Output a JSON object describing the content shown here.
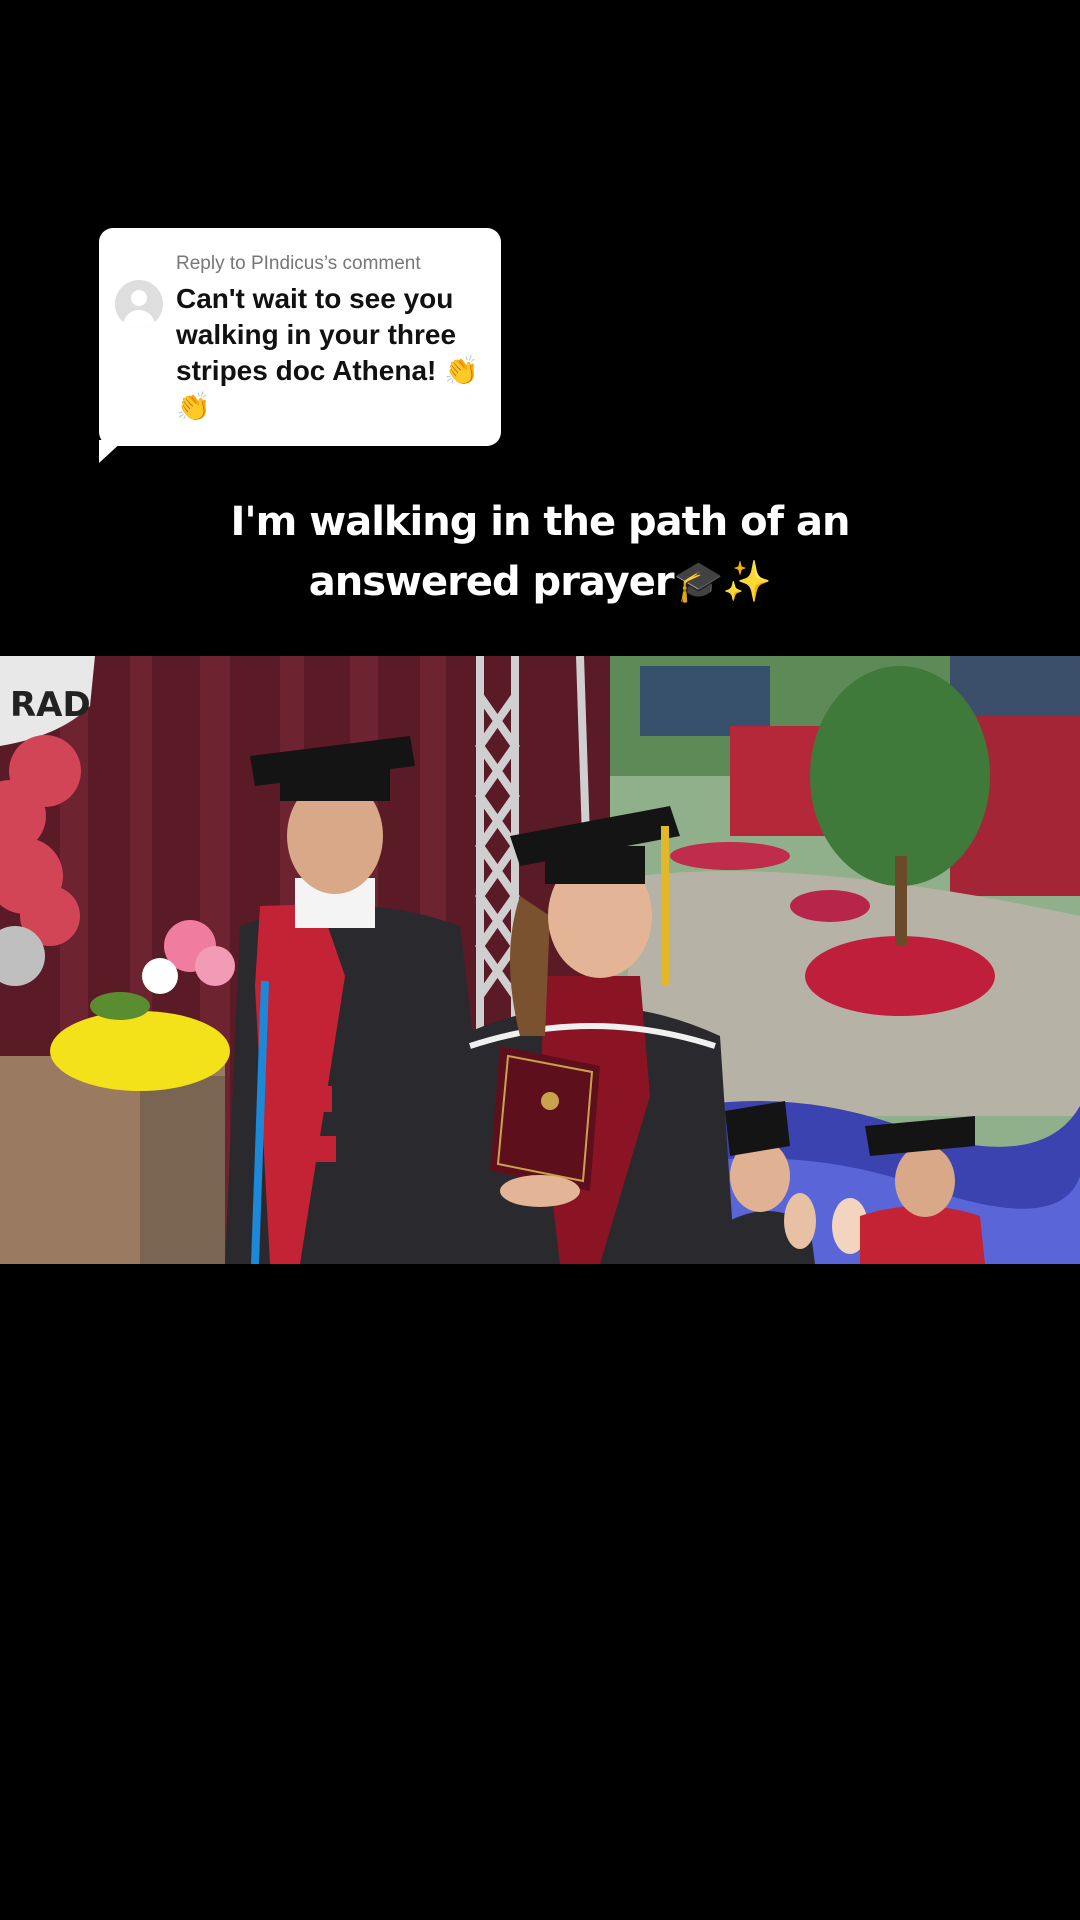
{
  "reply": {
    "header": "Reply to PIndicus’s comment",
    "text": "Can't wait to see you walking in your three stripes doc Athena! 👏👏"
  },
  "caption": {
    "line1": "I'm walking in the path of an",
    "line2": "answered prayer🎓✨"
  },
  "video": {
    "banner_text": "RAD"
  }
}
